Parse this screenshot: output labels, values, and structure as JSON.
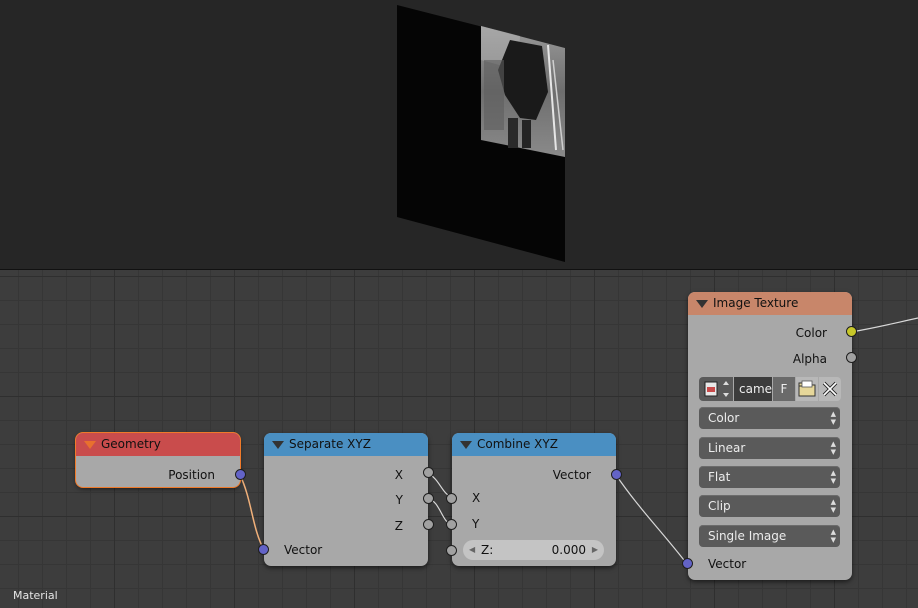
{
  "viewport": {
    "background": "#262626",
    "plane_color": "#050505"
  },
  "editor": {
    "footer_label": "Material"
  },
  "nodes": {
    "geometry": {
      "title": "Geometry",
      "header_color": "#c94c4c",
      "outputs": [
        "Position"
      ]
    },
    "separate_xyz": {
      "title": "Separate XYZ",
      "header_color": "#4a8fc2",
      "outputs": [
        "X",
        "Y",
        "Z"
      ],
      "inputs": [
        "Vector"
      ]
    },
    "combine_xyz": {
      "title": "Combine XYZ",
      "header_color": "#4a8fc2",
      "outputs": [
        "Vector"
      ],
      "inputs": [
        "X",
        "Y"
      ],
      "z_field": {
        "label": "Z:",
        "value": "0.000"
      }
    },
    "image_texture": {
      "title": "Image Texture",
      "header_color": "#c8866a",
      "outputs": [
        "Color",
        "Alpha"
      ],
      "image": {
        "name": "came",
        "flag": "F"
      },
      "dropdowns": [
        "Color",
        "Linear",
        "Flat",
        "Clip",
        "Single Image"
      ],
      "inputs": [
        "Vector"
      ]
    }
  },
  "icons": [
    "image-browse-icon",
    "open-folder-icon",
    "close-icon",
    "collapse-triangle-icon"
  ]
}
